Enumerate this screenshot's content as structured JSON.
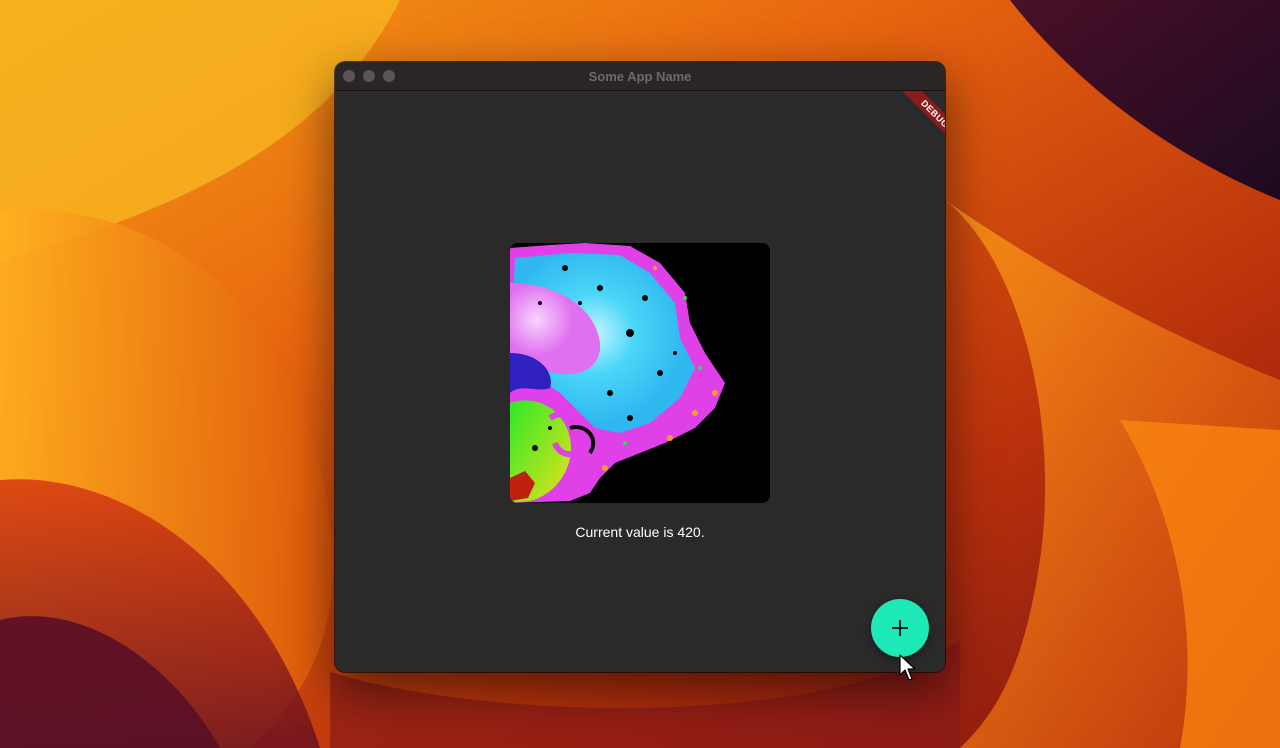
{
  "window": {
    "title": "Some App Name",
    "debug_banner": "DEBUG"
  },
  "main": {
    "value_text": "Current value is 420."
  },
  "fab": {
    "icon": "plus-icon",
    "color": "#1de9b6"
  },
  "colors": {
    "window_bg": "#2a2a2a",
    "titlebar_bg": "#2b2626",
    "banner_bg": "#8b1c1c"
  }
}
